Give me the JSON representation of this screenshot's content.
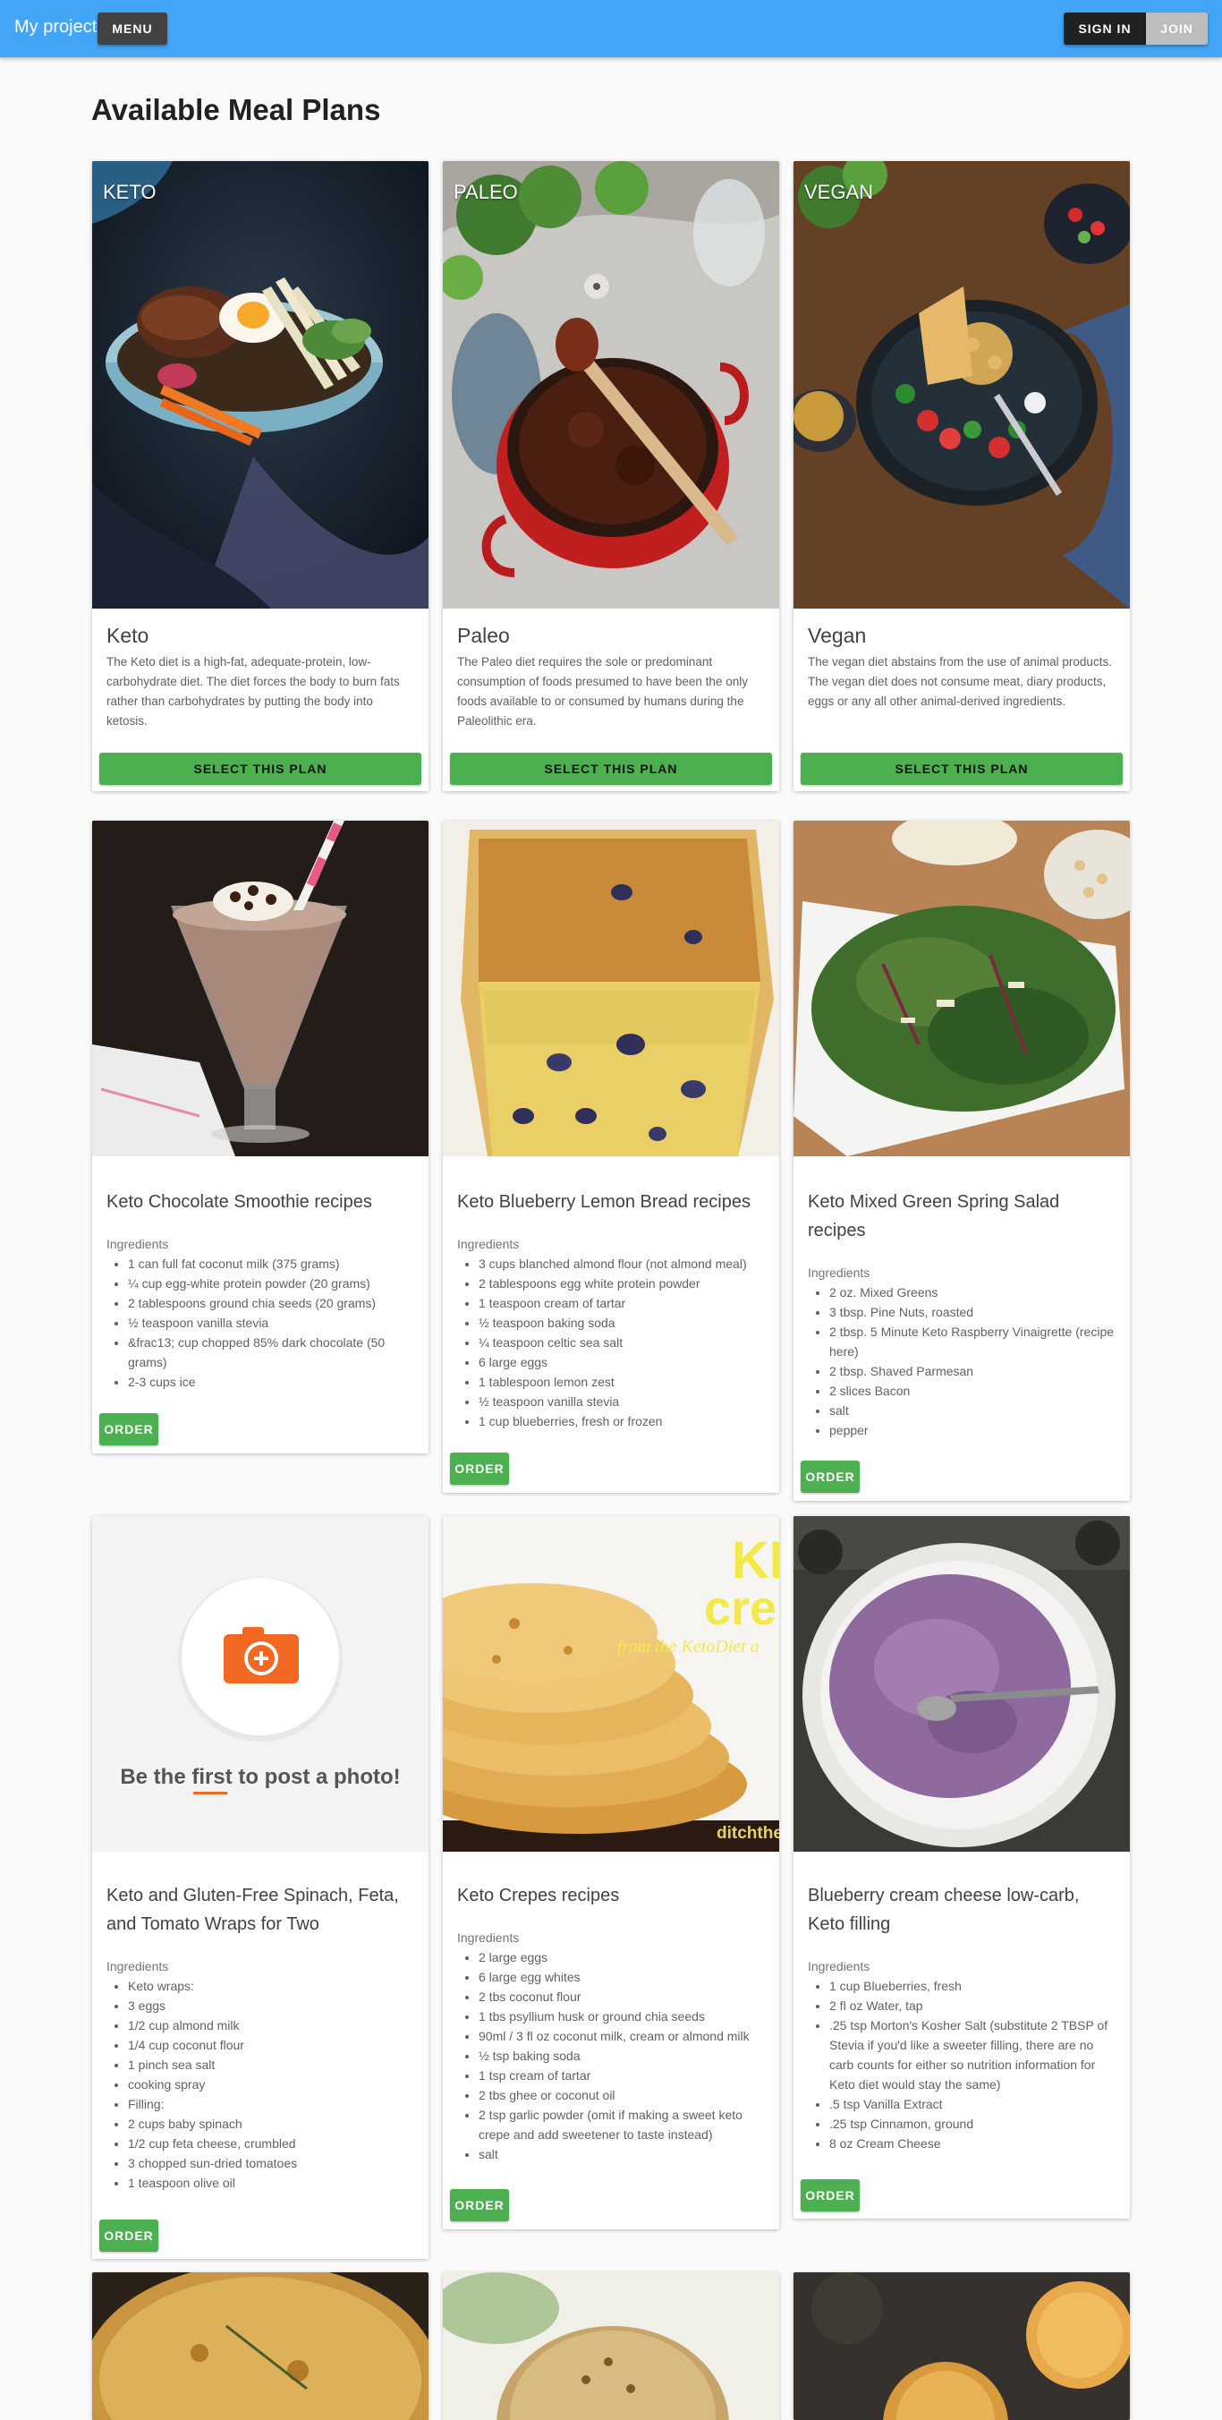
{
  "appbar": {
    "brand": "My project",
    "menu_label": "MENU",
    "signin_label": "SIGN IN",
    "join_label": "JOIN"
  },
  "page_title": "Available Meal Plans",
  "plans": [
    {
      "image_label": "KETO",
      "name": "Keto",
      "description": "The Keto diet is a high-fat, adequate-protein, low-carbohydrate diet. The diet forces the body to burn fats rather than carbohydrates by putting the body into ketosis.",
      "button": "SELECT THIS PLAN"
    },
    {
      "image_label": "PALEO",
      "name": "Paleo",
      "description": "The Paleo diet requires the sole or predominant consumption of foods presumed to have been the only foods available to or consumed by humans during the Paleolithic era.",
      "button": "SELECT THIS PLAN"
    },
    {
      "image_label": "VEGAN",
      "name": "Vegan",
      "description": "The vegan diet abstains from the use of animal products. The vegan diet does not consume meat, diary products, eggs or any all other animal-derived ingredients.",
      "button": "SELECT THIS PLAN"
    }
  ],
  "ingredients_label": "Ingredients",
  "order_label": "ORDER",
  "photo_placeholder": {
    "prefix": "Be the ",
    "highlight": "first",
    "suffix": " to post a photo!"
  },
  "crepes_overlay": {
    "big": "KE",
    "big2": "cre",
    "sub": "from the KetoDiet a",
    "site": "ditchthe"
  },
  "colors": {
    "appbar": "#42a5f5",
    "accent_green": "#4caf50",
    "camera_orange": "#f26722"
  },
  "recipes": [
    {
      "title": "Keto Chocolate Smoothie recipes",
      "ingredients": [
        "1 can full fat coconut milk (375 grams)",
        "¼ cup egg-white protein powder (20 grams)",
        "2 tablespoons ground chia seeds (20 grams)",
        "½ teaspoon vanilla stevia",
        "&frac13; cup chopped 85% dark chocolate (50 grams)",
        "2-3 cups ice"
      ]
    },
    {
      "title": "Keto Blueberry Lemon Bread recipes",
      "ingredients": [
        "3 cups blanched almond flour (not almond meal)",
        "2 tablespoons egg white protein powder",
        "1 teaspoon cream of tartar",
        "½ teaspoon baking soda",
        "¼ teaspoon celtic sea salt",
        "6 large eggs",
        "1 tablespoon lemon zest",
        "½ teaspoon vanilla stevia",
        "1 cup blueberries, fresh or frozen"
      ]
    },
    {
      "title": "Keto Mixed Green Spring Salad recipes",
      "ingredients": [
        "2 oz. Mixed Greens",
        "3 tbsp. Pine Nuts, roasted",
        "2 tbsp. 5 Minute Keto Raspberry Vinaigrette (recipe here)",
        "2 tbsp. Shaved Parmesan",
        "2 slices Bacon",
        "salt",
        "pepper"
      ]
    },
    {
      "title": "Keto and Gluten-Free Spinach, Feta, and Tomato Wraps for Two",
      "ingredients": [
        "Keto wraps:",
        "3 eggs",
        "1/2 cup almond milk",
        "1/4 cup coconut flour",
        "1 pinch sea salt",
        "cooking spray",
        "Filling:",
        "2 cups baby spinach",
        "1/2 cup feta cheese, crumbled",
        "3 chopped sun-dried tomatoes",
        "1 teaspoon olive oil"
      ]
    },
    {
      "title": "Keto Crepes recipes",
      "ingredients": [
        "2 large eggs",
        "6 large egg whites",
        "2 tbs coconut flour",
        "1 tbs psyllium husk or ground chia seeds",
        "90ml / 3 fl oz coconut milk, cream or almond milk",
        "½ tsp baking soda",
        "1 tsp cream of tartar",
        "2 tbs ghee or coconut oil",
        "2 tsp garlic powder (omit if making a sweet keto crepe and add sweetener to taste instead)",
        "salt"
      ]
    },
    {
      "title": "Blueberry cream cheese low-carb, Keto filling",
      "ingredients": [
        "1 cup Blueberries, fresh",
        "2 fl oz Water, tap",
        ".25 tsp Morton's Kosher Salt (substitute 2 TBSP of Stevia if you'd like a sweeter filling, there are no carb counts for either so nutrition information for Keto diet would stay the same)",
        ".5 tsp Vanilla Extract",
        ".25 tsp Cinnamon, ground",
        "8 oz Cream Cheese"
      ]
    }
  ]
}
